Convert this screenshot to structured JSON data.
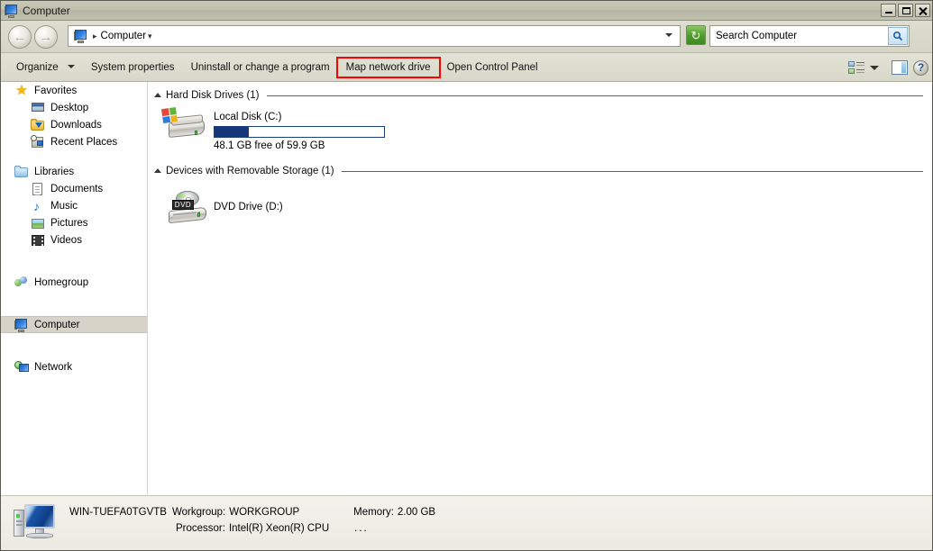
{
  "window": {
    "title": "Computer",
    "title_icon": "computer-icon",
    "buttons": {
      "minimize": "minimize-button",
      "maximize": "maximize-button",
      "close": "close-button"
    }
  },
  "navigation": {
    "back_label": "←",
    "forward_label": "→",
    "address": {
      "icon": "computer-icon",
      "separator": "▸",
      "crumb": "Computer",
      "crumb_caret": "▾"
    },
    "refresh_icon": "↻",
    "search": {
      "placeholder": "Search Computer",
      "value": "",
      "button_icon": "search-icon"
    }
  },
  "commandbar": {
    "items": [
      {
        "label": "Organize",
        "has_caret": true,
        "highlighted": false
      },
      {
        "label": "System properties",
        "has_caret": false,
        "highlighted": false
      },
      {
        "label": "Uninstall or change a program",
        "has_caret": false,
        "highlighted": false
      },
      {
        "label": "Map network drive",
        "has_caret": false,
        "highlighted": true
      },
      {
        "label": "Open Control Panel",
        "has_caret": false,
        "highlighted": false
      }
    ],
    "highlight_color": "#ff0000",
    "right_controls": {
      "views_icon": "views-icon",
      "views_caret": "▾",
      "preview_pane_icon": "preview-pane-icon",
      "help_icon": "?"
    }
  },
  "sidebar": {
    "groups": [
      {
        "root": {
          "label": "Favorites",
          "icon": "star-icon"
        },
        "children": [
          {
            "label": "Desktop",
            "icon": "desktop-icon"
          },
          {
            "label": "Downloads",
            "icon": "downloads-folder-icon"
          },
          {
            "label": "Recent Places",
            "icon": "recent-places-icon"
          }
        ]
      },
      {
        "root": {
          "label": "Libraries",
          "icon": "libraries-folder-icon"
        },
        "children": [
          {
            "label": "Documents",
            "icon": "document-icon"
          },
          {
            "label": "Music",
            "icon": "music-note-icon"
          },
          {
            "label": "Pictures",
            "icon": "picture-icon"
          },
          {
            "label": "Videos",
            "icon": "video-icon"
          }
        ]
      },
      {
        "root": {
          "label": "Homegroup",
          "icon": "homegroup-icon"
        },
        "children": []
      },
      {
        "root": {
          "label": "Computer",
          "icon": "computer-icon",
          "selected": true
        },
        "children": []
      },
      {
        "root": {
          "label": "Network",
          "icon": "network-icon"
        },
        "children": []
      }
    ],
    "selected_item": "Computer"
  },
  "content": {
    "groups": [
      {
        "title": "Hard Disk Drives (1)",
        "collapsed": false,
        "items": [
          {
            "name": "Local Disk (C:)",
            "icon": "hard-drive-icon",
            "free_text": "48.1 GB free of 59.9 GB",
            "free_gb": 48.1,
            "total_gb": 59.9,
            "used_percent": 20,
            "bar_fill_color": "#16377a",
            "bar_border_color": "#1a3d7c"
          }
        ]
      },
      {
        "title": "Devices with Removable Storage (1)",
        "collapsed": false,
        "items": [
          {
            "name": "DVD Drive (D:)",
            "icon": "dvd-drive-icon",
            "badge": "DVD"
          }
        ]
      }
    ]
  },
  "details": {
    "icon": "computer-large-icon",
    "computer_name": "WIN-TUEFA0TGVTB",
    "workgroup_label": "Workgroup:",
    "workgroup_value": "WORKGROUP",
    "memory_label": "Memory:",
    "memory_value": "2.00 GB",
    "processor_label": "Processor:",
    "processor_value": "Intel(R) Xeon(R) CPU",
    "processor_ellipsis": "..."
  }
}
